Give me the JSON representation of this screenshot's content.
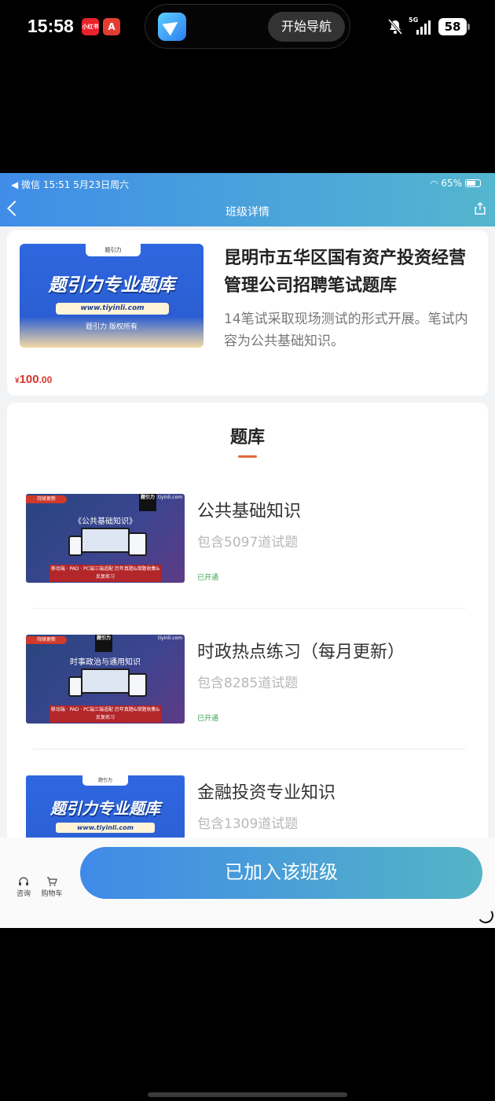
{
  "phone_status": {
    "time": "15:58",
    "badge_1": "小红书",
    "badge_2": "A",
    "island_pill": "开始导航",
    "network": "5G",
    "battery": "58"
  },
  "inner_status": {
    "left": "◀ 微信   15:51   5月23日周六",
    "battery": "65%"
  },
  "nav": {
    "title": "班级详情"
  },
  "course": {
    "cover": {
      "logo": "题引力",
      "title": "题引力专业题库",
      "url": "www.tiyinli.com",
      "copyright": "题引力 版权所有"
    },
    "title": "昆明市五华区国有资产投资经营管理公司招聘笔试题库",
    "description": "14笔试采取现场测试的形式开展。笔试内容为公共基础知识。",
    "price_symbol": "¥",
    "price_integer": "100",
    "price_decimal": ".00"
  },
  "question_bank": {
    "heading": "题库",
    "items": [
      {
        "title": "公共基础知识",
        "count": "包含5097道试题",
        "status": "已开通",
        "thumb_tag": "持续更新",
        "thumb_brand": "tiyinli.com",
        "thumb_logo": "题引力",
        "thumb_title": "《公共基础知识》",
        "thumb_band": "移动端 · PAD · PC端三端适配 历年真题&错题收集&反复练习"
      },
      {
        "title": "时政热点练习（每月更新）",
        "count": "包含8285道试题",
        "status": "已开通",
        "thumb_tag": "持续更新",
        "thumb_brand": "tiyinli.com",
        "thumb_logo": "题引力",
        "thumb_title": "时事政治与通用知识",
        "thumb_band": "移动端 · PAD · PC端三端适配 历年真题&错题收集&反复练习"
      },
      {
        "title": "金融投资专业知识",
        "count": "包含1309道试题",
        "thumb_logo": "题引力",
        "thumb_title": "题引力专业题库",
        "thumb_url": "www.tiyinli.com"
      }
    ]
  },
  "bottom_bar": {
    "consult_label": "咨询",
    "cart_label": "购物车",
    "join_label": "已加入该班级"
  },
  "colors": {
    "header_gradient_start": "#3f8de8",
    "header_gradient_end": "#54b6cf",
    "price": "#d8342b",
    "status_green": "#3ba34e",
    "underline": "#e0683b"
  }
}
